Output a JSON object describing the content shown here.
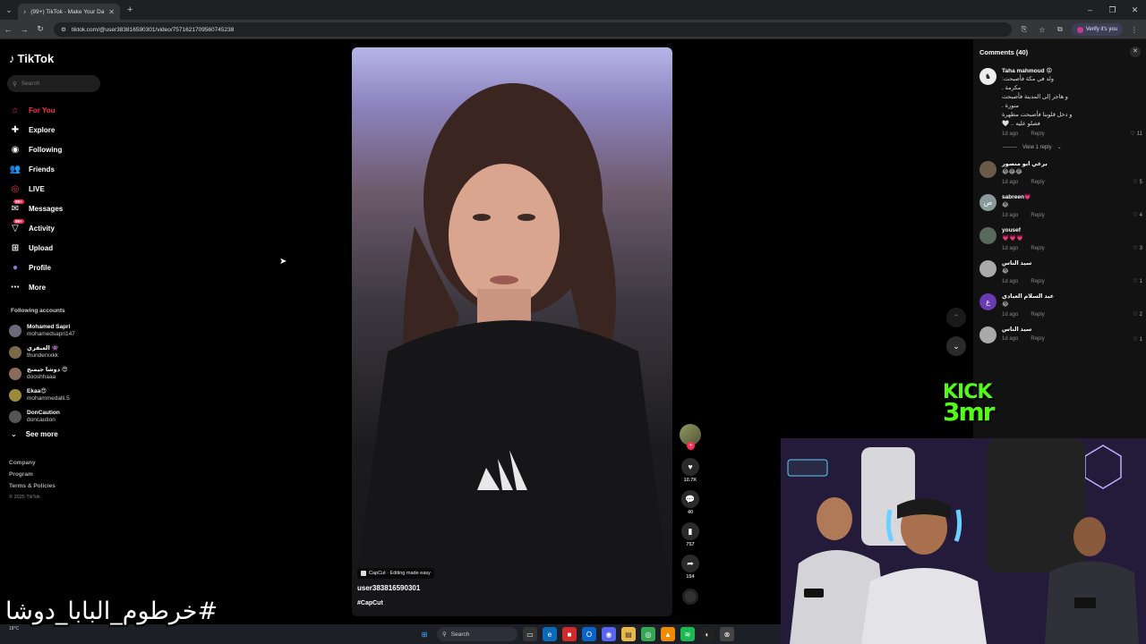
{
  "browser": {
    "tab_title": "(99+) TikTok - Make Your Day",
    "url": "tiktok.com/@user383816590301/video/7571621709560745238",
    "verify_label": "Verify it's you"
  },
  "sidebar": {
    "logo": "TikTok",
    "search_placeholder": "Search",
    "nav": [
      {
        "label": "For You",
        "icon": "home-icon"
      },
      {
        "label": "Explore",
        "icon": "compass-icon"
      },
      {
        "label": "Following",
        "icon": "following-icon"
      },
      {
        "label": "Friends",
        "icon": "friends-icon"
      },
      {
        "label": "LIVE",
        "icon": "live-icon"
      },
      {
        "label": "Messages",
        "icon": "messages-icon",
        "badge": "99+"
      },
      {
        "label": "Activity",
        "icon": "activity-icon",
        "badge": "99+"
      },
      {
        "label": "Upload",
        "icon": "upload-icon"
      },
      {
        "label": "Profile",
        "icon": "profile-icon"
      },
      {
        "label": "More",
        "icon": "more-icon"
      }
    ],
    "following_title": "Following accounts",
    "accounts": [
      {
        "name": "Mohamed Sapri",
        "user": "mohamedsapri147"
      },
      {
        "name": "العبقري 👾",
        "user": "thunderxxkk"
      },
      {
        "name": "دوشا جيمنج 😍",
        "user": "dooshhaaa"
      },
      {
        "name": "Ekaa😍",
        "user": "mohammedalli.5"
      },
      {
        "name": "DonCaution",
        "user": "doncaution"
      }
    ],
    "see_more": "See more",
    "footer": {
      "company": "Company",
      "program": "Program",
      "terms": "Terms & Policies",
      "copyright": "© 2025 TikTok"
    }
  },
  "video": {
    "capcut_label": "CapCut · Editing made easy",
    "username": "user383816590301",
    "hashtag": "#CapCut",
    "likes": "10.7K",
    "comments": "40",
    "saves": "757",
    "shares": "154"
  },
  "comments_panel": {
    "title": "Comments (40)",
    "items": [
      {
        "user": "Taha mahmoud 😡",
        "text": "ولد في مكة فأصبحت:\nمكرمة .\nو هاجر إلى المدينة فأصبحت\nمنورة .\nو دخل قلوبنا فأصبحت مطهرة\nفصلو عليه .. 🤍",
        "time": "1d ago",
        "reply": "Reply",
        "likes": "11"
      },
      {
        "user": "برعي ابو منصور",
        "text": "😂😂😂",
        "time": "1d ago",
        "reply": "Reply",
        "likes": "5"
      },
      {
        "user": "sabreen💗",
        "text": "😂",
        "time": "1d ago",
        "reply": "Reply",
        "likes": "4"
      },
      {
        "user": "yousef",
        "text": "💗💗💗",
        "time": "1d ago",
        "reply": "Reply",
        "likes": "3"
      },
      {
        "user": "سيد الناس",
        "text": "😂",
        "time": "1d ago",
        "reply": "Reply",
        "likes": "1"
      },
      {
        "user": "عبد السلام العبادي",
        "text": "😂",
        "time": "1d ago",
        "reply": "Reply",
        "likes": "2"
      },
      {
        "user": "سيد الناس",
        "text": "",
        "time": "1d ago",
        "reply": "Reply",
        "likes": "1"
      }
    ],
    "view_reply": "View 1 reply"
  },
  "overlays": {
    "kick_line1": "KICK",
    "kick_line2": "3mr",
    "hashtag": "#خرطوم_البابا_دوشا"
  },
  "taskbar": {
    "search_label": "Search",
    "weather": "18°C"
  },
  "colors": {
    "accent": "#fe2c55",
    "kick_green": "#53fc18"
  }
}
